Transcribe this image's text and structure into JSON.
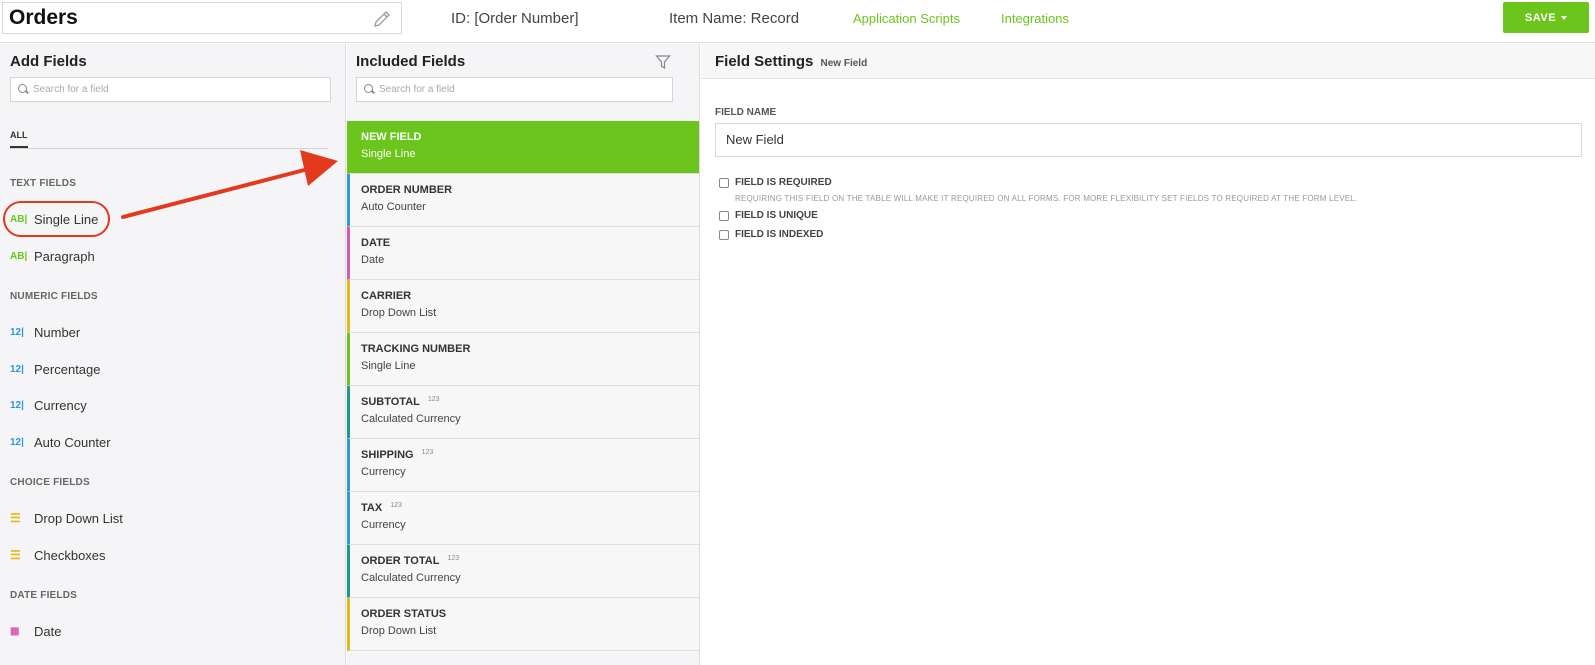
{
  "header": {
    "title": "Orders",
    "id_text": "ID: [Order Number]",
    "item_name": "Item Name: Record",
    "links": [
      "Application Scripts",
      "Integrations"
    ],
    "save_label": "SAVE",
    "accent_color": "#6cc51c"
  },
  "add_fields": {
    "title": "Add Fields",
    "search_placeholder": "Search for a field",
    "tab_all": "ALL",
    "sections": {
      "text": "TEXT FIELDS",
      "numeric": "NUMERIC FIELDS",
      "choice": "CHOICE FIELDS",
      "date": "DATE FIELDS"
    },
    "items": [
      {
        "icon": "AB|",
        "label": "Single Line"
      },
      {
        "icon": "AB|",
        "label": "Paragraph"
      },
      {
        "icon": "12|",
        "label": "Number"
      },
      {
        "icon": "12|",
        "label": "Percentage"
      },
      {
        "icon": "12|",
        "label": "Currency"
      },
      {
        "icon": "12|",
        "label": "Auto Counter"
      },
      {
        "icon": "☰",
        "label": "Drop Down List"
      },
      {
        "icon": "☰",
        "label": "Checkboxes"
      },
      {
        "icon": "▦",
        "label": "Date"
      }
    ]
  },
  "included_fields": {
    "title": "Included Fields",
    "search_placeholder": "Search for a field",
    "rows": [
      {
        "name": "NEW FIELD",
        "type": "Single Line",
        "badge": "",
        "color": "#6cc51c",
        "selected": true
      },
      {
        "name": "ORDER NUMBER",
        "type": "Auto Counter",
        "badge": "",
        "color": "#2a9bd6"
      },
      {
        "name": "DATE",
        "type": "Date",
        "badge": "",
        "color": "#d65ab4"
      },
      {
        "name": "CARRIER",
        "type": "Drop Down List",
        "badge": "",
        "color": "#e3b81a"
      },
      {
        "name": "TRACKING NUMBER",
        "type": "Single Line",
        "badge": "",
        "color": "#6cc51c"
      },
      {
        "name": "SUBTOTAL",
        "type": "Calculated Currency",
        "badge": "123",
        "color": "#1a9a8a"
      },
      {
        "name": "SHIPPING",
        "type": "Currency",
        "badge": "123",
        "color": "#2a9bd6"
      },
      {
        "name": "TAX",
        "type": "Currency",
        "badge": "123",
        "color": "#2a9bd6"
      },
      {
        "name": "ORDER TOTAL",
        "type": "Calculated Currency",
        "badge": "123",
        "color": "#1a9a8a"
      },
      {
        "name": "ORDER STATUS",
        "type": "Drop Down List",
        "badge": "",
        "color": "#e3b81a"
      }
    ]
  },
  "field_settings": {
    "title": "Field Settings",
    "subtitle": "New Field",
    "field_name_label": "FIELD NAME",
    "field_name_value": "New Field",
    "required_label": "FIELD IS REQUIRED",
    "required_note": "REQUIRING THIS FIELD ON THE TABLE WILL MAKE IT REQUIRED ON ALL FORMS. FOR MORE FLEXIBILITY SET FIELDS TO REQUIRED AT THE FORM LEVEL.",
    "unique_label": "FIELD IS UNIQUE",
    "indexed_label": "FIELD IS INDEXED"
  }
}
